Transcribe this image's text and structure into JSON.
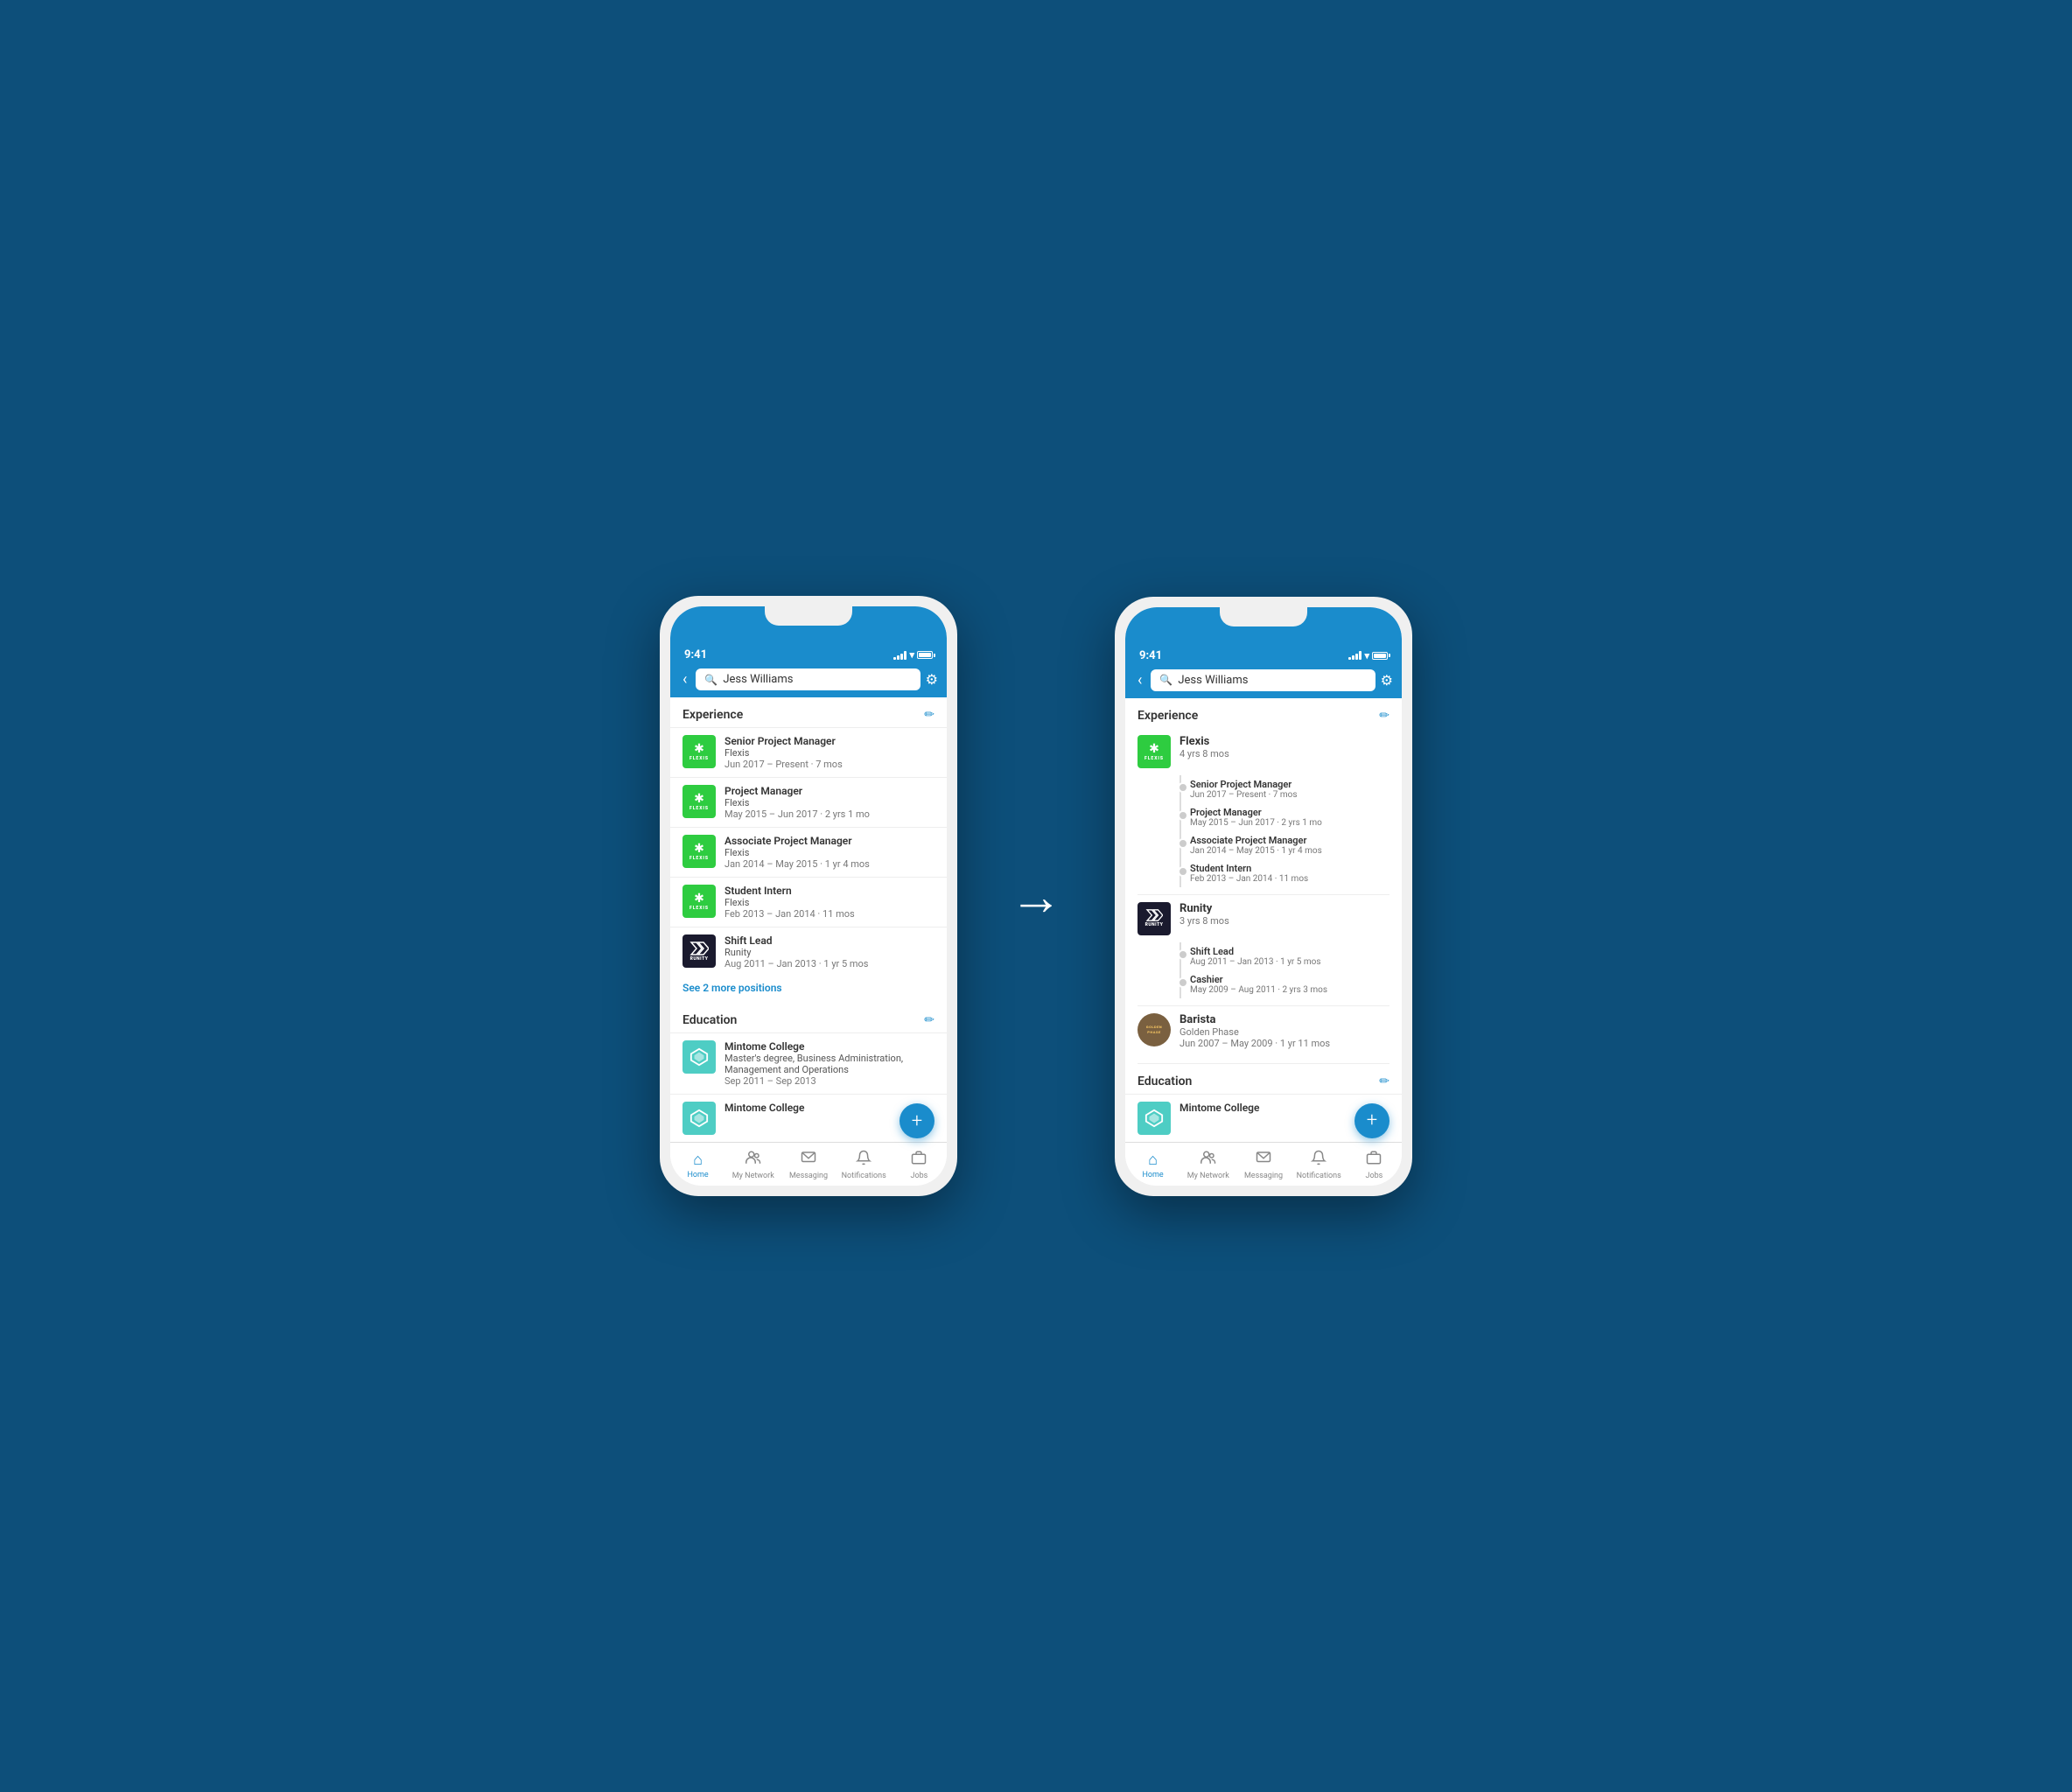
{
  "scene": {
    "arrow": "→"
  },
  "phone_left": {
    "status": {
      "time": "9:41"
    },
    "header": {
      "search_placeholder": "Jess Williams",
      "back_label": "‹",
      "settings_label": "⚙"
    },
    "experience_section": {
      "title": "Experience",
      "edit_icon": "✏"
    },
    "experience_items": [
      {
        "logo_type": "flexis",
        "title": "Senior Project Manager",
        "company": "Flexis",
        "date": "Jun 2017 – Present · 7 mos"
      },
      {
        "logo_type": "flexis",
        "title": "Project Manager",
        "company": "Flexis",
        "date": "May 2015 – Jun 2017 · 2 yrs 1 mo"
      },
      {
        "logo_type": "flexis",
        "title": "Associate Project Manager",
        "company": "Flexis",
        "date": "Jan 2014 – May 2015 · 1 yr 4 mos"
      },
      {
        "logo_type": "flexis",
        "title": "Student Intern",
        "company": "Flexis",
        "date": "Feb 2013 – Jan 2014 · 11 mos"
      },
      {
        "logo_type": "runity",
        "title": "Shift Lead",
        "company": "Runity",
        "date": "Aug 2011 – Jan 2013 · 1 yr 5 mos"
      }
    ],
    "see_more_label": "See 2 more positions",
    "education_section": {
      "title": "Education",
      "edit_icon": "✏"
    },
    "education_items": [
      {
        "logo_type": "mintome",
        "school": "Mintome College",
        "degree": "Master's degree, Business Administration, Management and Operations",
        "date": "Sep 2011 – Sep 2013"
      },
      {
        "logo_type": "mintome",
        "school": "Mintome College",
        "degree": "",
        "date": ""
      }
    ],
    "fab_label": "+",
    "nav_items": [
      {
        "icon": "⌂",
        "label": "Home",
        "active": true
      },
      {
        "icon": "👥",
        "label": "My Network",
        "active": false
      },
      {
        "icon": "💬",
        "label": "Messaging",
        "active": false
      },
      {
        "icon": "🔔",
        "label": "Notifications",
        "active": false
      },
      {
        "icon": "💼",
        "label": "Jobs",
        "active": false
      }
    ]
  },
  "phone_right": {
    "status": {
      "time": "9:41"
    },
    "header": {
      "search_placeholder": "Jess Williams",
      "back_label": "‹",
      "settings_label": "⚙"
    },
    "experience_section": {
      "title": "Experience",
      "edit_icon": "✏"
    },
    "grouped_companies": [
      {
        "logo_type": "flexis",
        "name": "Flexis",
        "duration": "4 yrs 8 mos",
        "roles": [
          {
            "title": "Senior Project Manager",
            "date": "Jun 2017 – Present · 7 mos"
          },
          {
            "title": "Project Manager",
            "date": "May 2015 – Jun 2017 · 2 yrs 1 mo"
          },
          {
            "title": "Associate Project Manager",
            "date": "Jan 2014 – May 2015 · 1 yr 4 mos"
          },
          {
            "title": "Student Intern",
            "date": "Feb 2013 – Jan 2014 · 11 mos"
          }
        ]
      },
      {
        "logo_type": "runity",
        "name": "Runity",
        "duration": "3 yrs 8 mos",
        "roles": [
          {
            "title": "Shift Lead",
            "date": "Aug 2011 – Jan 2013 · 1 yr 5 mos"
          },
          {
            "title": "Cashier",
            "date": "May 2009 – Aug 2011 · 2 yrs 3 mos"
          }
        ]
      },
      {
        "logo_type": "golden",
        "name": "Barista",
        "company_sub": "Golden Phase",
        "duration": "Jun 2007 – May 2009 · 1 yr 11 mos",
        "roles": []
      }
    ],
    "education_section": {
      "title": "Education",
      "edit_icon": "✏"
    },
    "education_items": [
      {
        "logo_type": "mintome",
        "school": "Mintome College",
        "degree": "",
        "date": ""
      }
    ],
    "fab_label": "+",
    "nav_items": [
      {
        "icon": "⌂",
        "label": "Home",
        "active": true
      },
      {
        "icon": "👥",
        "label": "My Network",
        "active": false
      },
      {
        "icon": "💬",
        "label": "Messaging",
        "active": false
      },
      {
        "icon": "🔔",
        "label": "Notifications",
        "active": false
      },
      {
        "icon": "💼",
        "label": "Jobs",
        "active": false
      }
    ]
  }
}
